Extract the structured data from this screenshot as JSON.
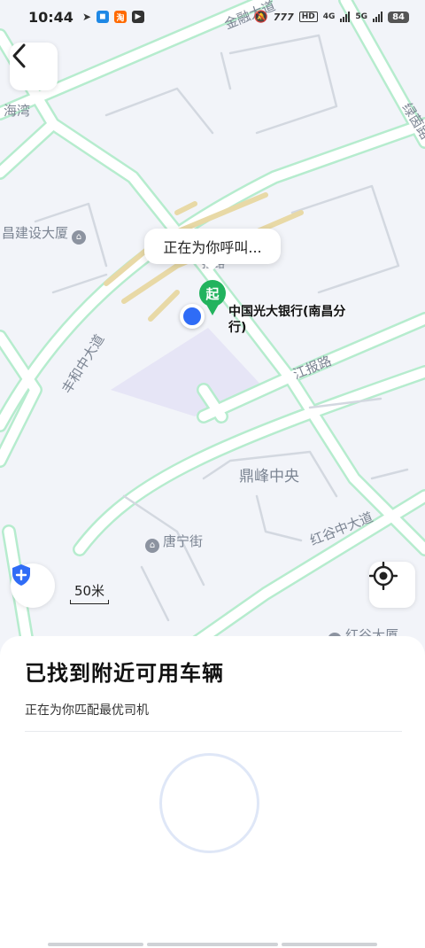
{
  "status_bar": {
    "time": "10:44",
    "network_1": "HD",
    "network_2": "4G",
    "network_3": "5G",
    "battery": "84"
  },
  "map": {
    "labels": {
      "road_jinrongdadao": "金融大道",
      "area_haiwan": "海湾",
      "road_lvyin": "绿茵路",
      "poi_jianshe": "昌建设大厦",
      "road_fenghe": "丰和中大道",
      "road_jiangbao": "江报路",
      "area_dingfeng": "鼎峰中央",
      "road_honggu": "红谷中大道",
      "poi_tangning": "唐宁街",
      "poi_honggu": "红谷大厦",
      "road_small": "报路"
    },
    "call_bubble": "正在为你呼叫...",
    "start_marker": "起",
    "start_place": "中国光大银行(南昌分行)",
    "scale": "50米"
  },
  "sheet": {
    "title": "已找到附近可用车辆",
    "subtitle": "正在为你匹配最优司机"
  },
  "colors": {
    "road_outline": "#b6ecce",
    "marker_green": "#22b35e",
    "user_blue": "#2f6cf6",
    "rail": "#e8d9a6"
  },
  "icons": [
    "back-arrow-icon",
    "shield-icon",
    "locate-icon",
    "poi-pin-icon"
  ]
}
